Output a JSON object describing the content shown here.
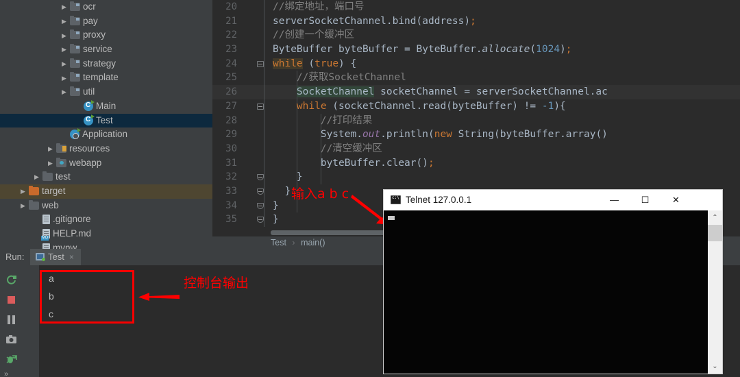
{
  "project_tree": {
    "items": [
      {
        "label": "ocr",
        "icon": "folder-icon",
        "indent": 4,
        "arrow": "▶",
        "kind": "folder",
        "state": "normal"
      },
      {
        "label": "pay",
        "icon": "folder-icon",
        "indent": 4,
        "arrow": "▶",
        "kind": "folder",
        "state": "normal"
      },
      {
        "label": "proxy",
        "icon": "folder-icon",
        "indent": 4,
        "arrow": "▶",
        "kind": "folder",
        "state": "normal"
      },
      {
        "label": "service",
        "icon": "folder-icon",
        "indent": 4,
        "arrow": "▶",
        "kind": "folder",
        "state": "normal"
      },
      {
        "label": "strategy",
        "icon": "folder-icon",
        "indent": 4,
        "arrow": "▶",
        "kind": "folder",
        "state": "normal"
      },
      {
        "label": "template",
        "icon": "folder-icon",
        "indent": 4,
        "arrow": "▶",
        "kind": "folder",
        "state": "normal"
      },
      {
        "label": "util",
        "icon": "folder-icon",
        "indent": 4,
        "arrow": "▶",
        "kind": "folder",
        "state": "normal"
      },
      {
        "label": "Main",
        "icon": "java-class-icon",
        "indent": 5,
        "arrow": "",
        "kind": "class",
        "state": "normal"
      },
      {
        "label": "Test",
        "icon": "java-class-icon",
        "indent": 5,
        "arrow": "",
        "kind": "class",
        "state": "selected"
      },
      {
        "label": "Application",
        "icon": "spring-app-icon",
        "indent": 4,
        "arrow": "",
        "kind": "app",
        "state": "normal"
      },
      {
        "label": "resources",
        "icon": "resources-folder-icon",
        "indent": 3,
        "arrow": "▶",
        "kind": "resources",
        "state": "normal"
      },
      {
        "label": "webapp",
        "icon": "webapp-folder-icon",
        "indent": 3,
        "arrow": "▶",
        "kind": "webapp",
        "state": "normal"
      },
      {
        "label": "test",
        "icon": "folder-icon",
        "indent": 2,
        "arrow": "▶",
        "kind": "plainfolder",
        "state": "normal"
      },
      {
        "label": "target",
        "icon": "target-folder-icon",
        "indent": 1,
        "arrow": "▶",
        "kind": "orangefolder",
        "state": "target"
      },
      {
        "label": "web",
        "icon": "folder-icon",
        "indent": 1,
        "arrow": "▶",
        "kind": "plainfolder",
        "state": "normal"
      },
      {
        "label": ".gitignore",
        "icon": "file-icon",
        "indent": 2,
        "arrow": "",
        "kind": "file",
        "state": "normal"
      },
      {
        "label": "HELP.md",
        "icon": "markdown-file-icon",
        "indent": 2,
        "arrow": "",
        "kind": "mdfile",
        "state": "normal"
      },
      {
        "label": "mvnw",
        "icon": "file-icon",
        "indent": 2,
        "arrow": "",
        "kind": "file",
        "state": "normal"
      }
    ]
  },
  "editor": {
    "lines": [
      {
        "num": "20",
        "fold": "",
        "indent": 0,
        "current": false,
        "tokens": [
          {
            "t": "//绑定地址，端口号",
            "c": "cmt"
          }
        ],
        "pad": 8
      },
      {
        "num": "21",
        "fold": "",
        "indent": 0,
        "current": false,
        "tokens": [
          {
            "t": "serverSocketChannel.bind(address)",
            "c": "pln"
          },
          {
            "t": ";",
            "c": "kw"
          }
        ],
        "pad": 8
      },
      {
        "num": "22",
        "fold": "",
        "indent": 0,
        "current": false,
        "tokens": [
          {
            "t": "//创建一个缓冲区",
            "c": "cmt"
          }
        ],
        "pad": 8
      },
      {
        "num": "23",
        "fold": "",
        "indent": 0,
        "current": false,
        "tokens": [
          {
            "t": "ByteBuffer byteBuffer = ByteBuffer.",
            "c": "pln"
          },
          {
            "t": "allocate",
            "c": "mth"
          },
          {
            "t": "(",
            "c": "pln"
          },
          {
            "t": "1024",
            "c": "num"
          },
          {
            "t": ")",
            "c": "pln"
          },
          {
            "t": ";",
            "c": "kw"
          }
        ],
        "pad": 8
      },
      {
        "num": "24",
        "fold": "start",
        "indent": 0,
        "current": false,
        "tokens": [
          {
            "t": "while",
            "c": "kw hl-kw"
          },
          {
            "t": " (",
            "c": "pln"
          },
          {
            "t": "true",
            "c": "kw"
          },
          {
            "t": ") {",
            "c": "pln"
          }
        ],
        "pad": 8
      },
      {
        "num": "25",
        "fold": "",
        "indent": 1,
        "current": false,
        "tokens": [
          {
            "t": "    //获取SocketChannel",
            "c": "cmt"
          }
        ],
        "pad": 8
      },
      {
        "num": "26",
        "fold": "",
        "indent": 1,
        "current": true,
        "tokens": [
          {
            "t": "    ",
            "c": "pln"
          },
          {
            "t": "SocketChannel",
            "c": "cls hl-id"
          },
          {
            "t": " socketChannel = serverSocketChannel.ac",
            "c": "pln"
          }
        ],
        "pad": 8
      },
      {
        "num": "27",
        "fold": "start",
        "indent": 1,
        "current": false,
        "tokens": [
          {
            "t": "    ",
            "c": "pln"
          },
          {
            "t": "while",
            "c": "kw"
          },
          {
            "t": " (socketChannel.read(byteBuffer) != ",
            "c": "pln"
          },
          {
            "t": "-1",
            "c": "num"
          },
          {
            "t": "){",
            "c": "pln"
          }
        ],
        "pad": 8
      },
      {
        "num": "28",
        "fold": "",
        "indent": 2,
        "current": false,
        "tokens": [
          {
            "t": "        //打印结果",
            "c": "cmt"
          }
        ],
        "pad": 8
      },
      {
        "num": "29",
        "fold": "",
        "indent": 2,
        "current": false,
        "tokens": [
          {
            "t": "        System.",
            "c": "pln"
          },
          {
            "t": "out",
            "c": "fld"
          },
          {
            "t": ".println(",
            "c": "pln"
          },
          {
            "t": "new",
            "c": "kw"
          },
          {
            "t": " String(byteBuffer.array()",
            "c": "pln"
          }
        ],
        "pad": 8
      },
      {
        "num": "30",
        "fold": "",
        "indent": 2,
        "current": false,
        "tokens": [
          {
            "t": "        //清空缓冲区",
            "c": "cmt"
          }
        ],
        "pad": 8
      },
      {
        "num": "31",
        "fold": "",
        "indent": 2,
        "current": false,
        "tokens": [
          {
            "t": "        byteBuffer.clear()",
            "c": "pln"
          },
          {
            "t": ";",
            "c": "kw"
          }
        ],
        "pad": 8
      },
      {
        "num": "32",
        "fold": "end",
        "indent": 2,
        "current": false,
        "tokens": [
          {
            "t": "    }",
            "c": "pln"
          }
        ],
        "pad": 8
      },
      {
        "num": "33",
        "fold": "end",
        "indent": 1,
        "current": false,
        "tokens": [
          {
            "t": "  }",
            "c": "pln"
          }
        ],
        "pad": 8
      },
      {
        "num": "34",
        "fold": "end",
        "indent": 1,
        "current": false,
        "tokens": [
          {
            "t": "}",
            "c": "pln"
          }
        ],
        "pad": 8
      },
      {
        "num": "35",
        "fold": "end",
        "indent": 0,
        "current": false,
        "tokens": [
          {
            "t": "}",
            "c": "pln"
          }
        ],
        "pad": 8
      }
    ],
    "breadcrumb": {
      "class": "Test",
      "separator": "›",
      "method": "main()"
    }
  },
  "run_tool": {
    "label": "Run:",
    "tab_label": "Test",
    "tab_close": "×",
    "console_lines": [
      "a",
      "b",
      "c"
    ],
    "left_toolbar": [
      {
        "name": "rerun-button",
        "glyph": ""
      },
      {
        "name": "stop-button",
        "glyph": ""
      },
      {
        "name": "pause-button",
        "glyph": ""
      },
      {
        "name": "screenshot-button",
        "glyph": ""
      },
      {
        "name": "attach-debugger-button",
        "glyph": ""
      },
      {
        "name": "expand-toolbar-button",
        "glyph": "»"
      }
    ],
    "right_toolbar": [
      {
        "name": "up-arrow-button",
        "glyph": "↑"
      },
      {
        "name": "down-arrow-button",
        "glyph": "↓"
      },
      {
        "name": "soft-wrap-button",
        "glyph": "↩"
      },
      {
        "name": "scroll-to-end-button",
        "glyph": "↓"
      },
      {
        "name": "print-button",
        "glyph": "⎙"
      },
      {
        "name": "trash-button",
        "glyph": "Ὕ1"
      }
    ]
  },
  "telnet_window": {
    "title": "Telnet 127.0.0.1",
    "icon": "console-icon",
    "minimize": "—",
    "maximize": "☐",
    "close": "✕",
    "scroll_up": "⌃",
    "scroll_down": "⌄",
    "body_text": ""
  },
  "annotations": {
    "console_output": "控制台输出",
    "input_abc": "输入a b c",
    "color": "#ff0000"
  }
}
